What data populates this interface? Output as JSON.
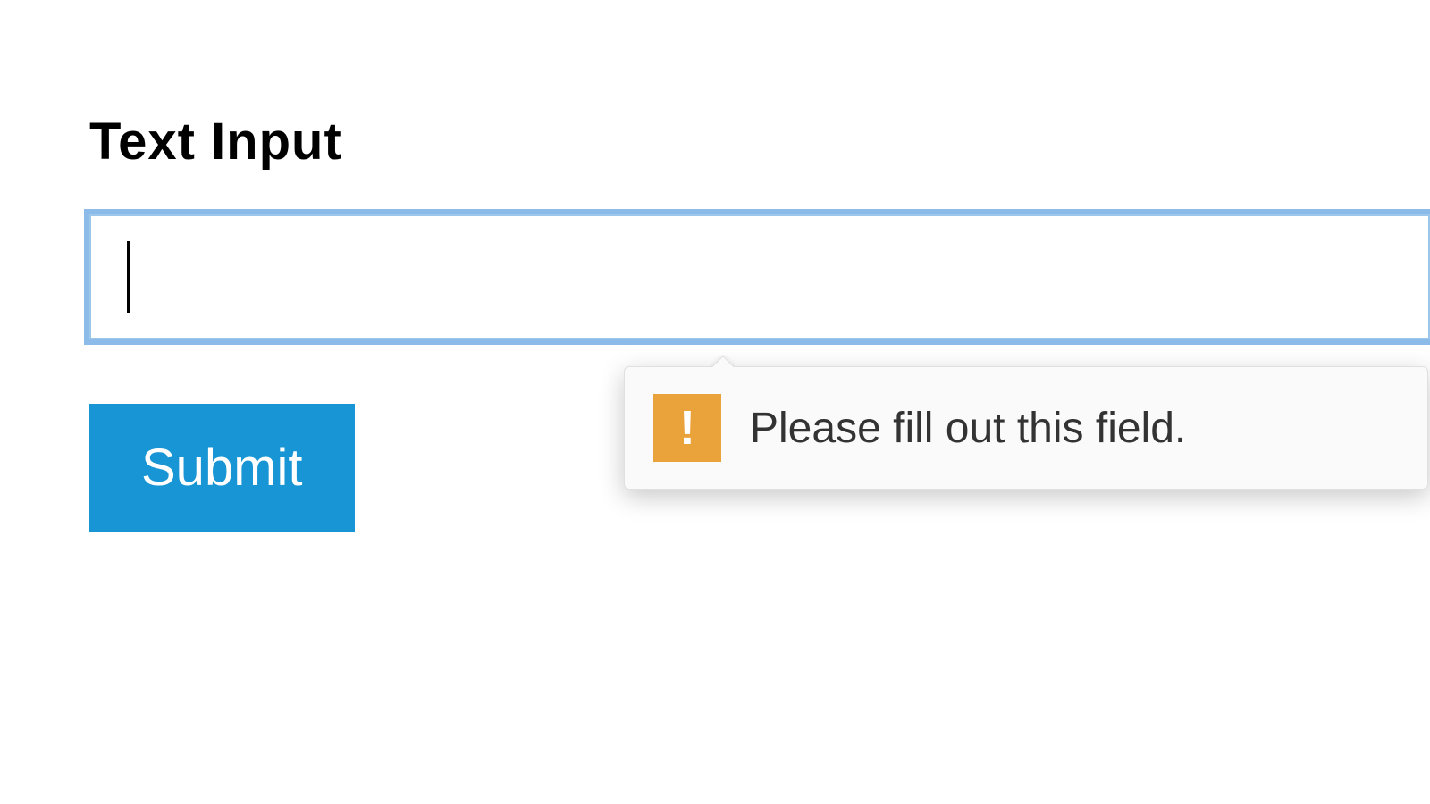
{
  "form": {
    "label": "Text Input",
    "input_value": "",
    "input_placeholder": "",
    "submit_label": "Submit"
  },
  "validation": {
    "icon_glyph": "!",
    "message": "Please fill out this field."
  },
  "colors": {
    "accent": "#1795d4",
    "focus_ring": "#8fbde6",
    "warning": "#e9a33a"
  }
}
